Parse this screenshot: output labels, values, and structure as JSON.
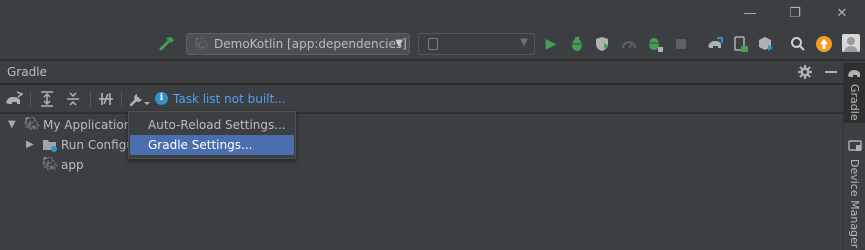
{
  "window": {
    "minimize_glyph": "—",
    "restore_glyph": "❐",
    "close_glyph": "✕"
  },
  "toolbar": {
    "run_config": "DemoKotlin [app:dependencies]",
    "device_placeholder": "",
    "icons": [
      "hammer-icon",
      "run-icon",
      "debug-icon",
      "coverage-icon",
      "profile-icon",
      "attach-debugger-icon",
      "stop-icon",
      "gradle-sync-icon",
      "device-manager-icon",
      "sdk-manager-icon",
      "search-icon",
      "update-icon",
      "user-icon"
    ]
  },
  "gradle_panel": {
    "title": "Gradle",
    "status_link": "Task list not built...",
    "popup_items": [
      {
        "label": "Auto-Reload Settings...",
        "selected": false
      },
      {
        "label": "Gradle Settings...",
        "selected": true
      }
    ],
    "tree": [
      {
        "label": "My Application",
        "expanded": true
      },
      {
        "label": "Run Configu",
        "expanded": false
      },
      {
        "label": "app"
      }
    ]
  },
  "side_tabs": [
    "Gradle",
    "Device Manager"
  ],
  "colors": {
    "background": "#2b2b2b",
    "panel": "#3c3f41",
    "selection": "#4b6eaf",
    "link": "#589df6",
    "run_green": "#499c54",
    "update_orange": "#f49c22",
    "info_blue": "#3592c4"
  }
}
